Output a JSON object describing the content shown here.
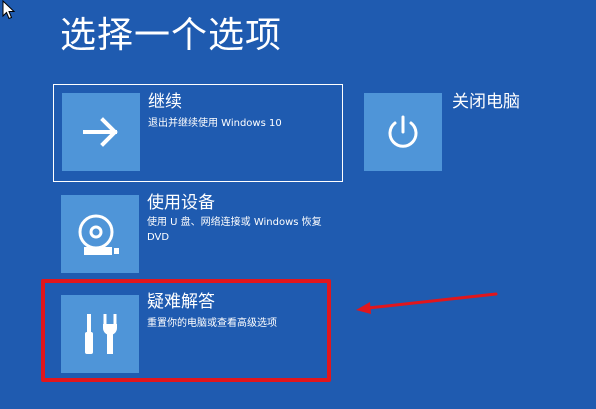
{
  "page": {
    "title": "选择一个选项"
  },
  "options": {
    "continue": {
      "title": "继续",
      "description": "退出并继续使用 Windows 10",
      "icon": "arrow-right-icon"
    },
    "shutdown": {
      "title": "关闭电脑",
      "icon": "power-icon"
    },
    "use_device": {
      "title": "使用设备",
      "description": "使用 U 盘、网络连接或 Windows 恢复 DVD",
      "icon": "disc-drive-icon"
    },
    "troubleshoot": {
      "title": "疑难解答",
      "description": "重置你的电脑或查看高级选项",
      "icon": "tools-icon"
    }
  },
  "colors": {
    "background": "#1f5bb0",
    "tile_icon_bg": "#4f95d8",
    "annotation": "#e1161c"
  }
}
